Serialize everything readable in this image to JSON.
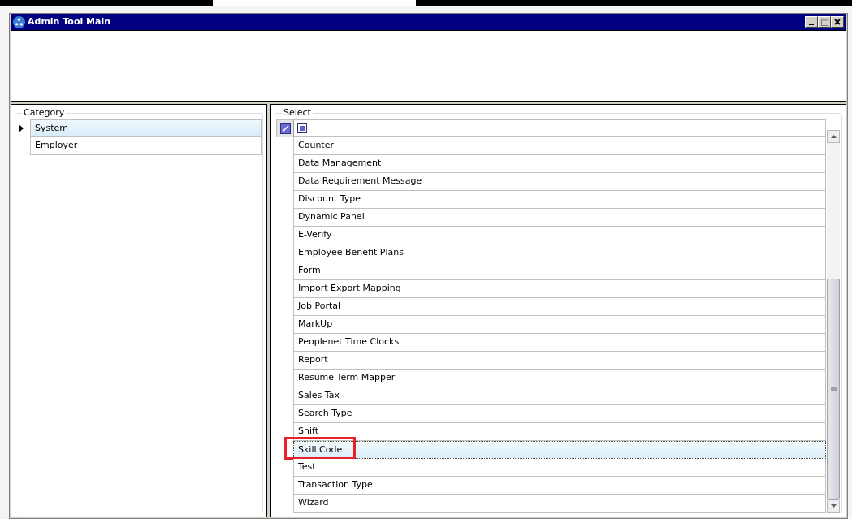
{
  "window": {
    "title": "Admin Tool Main"
  },
  "category": {
    "legend": "Category",
    "items": [
      {
        "label": "System",
        "selected": true
      },
      {
        "label": "Employer",
        "selected": false
      }
    ]
  },
  "select": {
    "legend": "Select",
    "items": [
      {
        "label": "Counter",
        "selected": false,
        "highlighted": false
      },
      {
        "label": "Data Management",
        "selected": false,
        "highlighted": false
      },
      {
        "label": "Data Requirement Message",
        "selected": false,
        "highlighted": false
      },
      {
        "label": "Discount Type",
        "selected": false,
        "highlighted": false
      },
      {
        "label": "Dynamic Panel",
        "selected": false,
        "highlighted": false
      },
      {
        "label": "E-Verify",
        "selected": false,
        "highlighted": false
      },
      {
        "label": "Employee Benefit Plans",
        "selected": false,
        "highlighted": false
      },
      {
        "label": "Form",
        "selected": false,
        "highlighted": false
      },
      {
        "label": "Import Export Mapping",
        "selected": false,
        "highlighted": false
      },
      {
        "label": "Job Portal",
        "selected": false,
        "highlighted": false
      },
      {
        "label": "MarkUp",
        "selected": false,
        "highlighted": false
      },
      {
        "label": "Peoplenet Time Clocks",
        "selected": false,
        "highlighted": false
      },
      {
        "label": "Report",
        "selected": false,
        "highlighted": false
      },
      {
        "label": "Resume Term Mapper",
        "selected": false,
        "highlighted": false
      },
      {
        "label": "Sales Tax",
        "selected": false,
        "highlighted": false
      },
      {
        "label": "Search Type",
        "selected": false,
        "highlighted": false
      },
      {
        "label": "Shift",
        "selected": false,
        "highlighted": false
      },
      {
        "label": "Skill Code",
        "selected": true,
        "highlighted": true
      },
      {
        "label": "Test",
        "selected": false,
        "highlighted": false
      },
      {
        "label": "Transaction Type",
        "selected": false,
        "highlighted": false
      },
      {
        "label": "Wizard",
        "selected": false,
        "highlighted": false
      }
    ]
  }
}
